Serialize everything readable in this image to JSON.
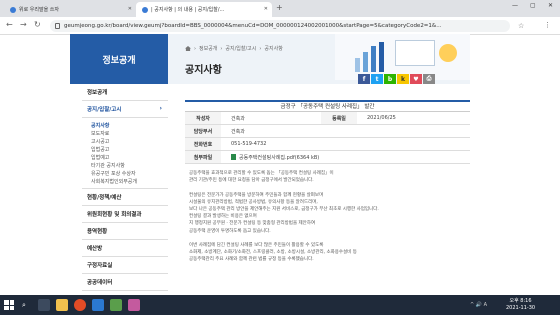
{
  "browser": {
    "tab1_title": "위로 우리말을 쓰자",
    "tab2_title": "| 공지사항 | 의 내용 | 공지/입찰/...",
    "url": "geumjeong.go.kr/board/view.geumj?boardId=BBS_0000004&menuCd=DOM_000000124002001000&startPage=5&categoryCode2=1&..."
  },
  "sidebar": {
    "header": "정보공개",
    "items": [
      {
        "label": "정보공개"
      },
      {
        "label": "공지/입찰/고시"
      },
      {
        "label": "현황/정책/예산"
      },
      {
        "label": "위원회현황 및 회의결과"
      },
      {
        "label": "용역현황"
      },
      {
        "label": "예산방"
      },
      {
        "label": "구정자료실"
      },
      {
        "label": "공공데이터"
      }
    ],
    "subitems": [
      "공지사항",
      "보도자료",
      "고시공고",
      "입법공고",
      "입법예고",
      "타기관 공지사항",
      "유공구민 포상 수상자",
      "사회복지법인외부공개"
    ]
  },
  "breadcrumb": [
    "정보공개",
    "공지/입찰/고시",
    "공지사항"
  ],
  "page_title": "공지사항",
  "share": [
    "f",
    "t",
    "b",
    "k",
    "♥",
    "⎙"
  ],
  "post": {
    "title": "금정구 「공동주택 컨설팅 사례집」 발간",
    "author_label": "작성자",
    "author": "건축과",
    "date_label": "등록일",
    "date": "2021/06/25",
    "dept_label": "담당부서",
    "dept": "건축과",
    "phone_label": "전화번호",
    "phone": "051-519-4732",
    "attach_label": "첨부파일",
    "attach": "공동주택컨설팅사례집.pdf(6364 kB)",
    "body": [
      "공동주택을 효과적으로 관리할 수 있도록 돕는 「공동주택 컨설팅 사례집」이",
      "관리 기관/주민 등에 대한 요청을 담아 금정구에서 발간되었습니다.",
      "",
      "컨설팅은 전문가가 공동주택을 방문하여 주민들과 함께 현황을 살펴보며",
      "시설물의 유지관리방법, 적법한 공사방법, 유의사항 등을 알려드리며,",
      "보다 나은 공동주택 관리 방안을 제안해주는 지원 서비스로, 금정구가 부산 최초로 시행한 사업입니다.",
      "컨설팅 결과 발생하는 비용은 없으며",
      "지 행정지원 공무원 · 전문가 컨설팅 등 맞춤형 관리방법을 제안하여",
      "공동주택 운영이 투명하도록 돕고 있습니다.",
      "",
      "이번 사례집에 담긴 컨설팅 사례를 보다 많은 주민들이 활용할 수 있도록",
      "소화제, 소방계단, 소화기/소화전, 스프링클러, 소방, 소방시설, 소방관리, 소화용수설비 등",
      "공동주택관리 주요 사례와 함께 관련 법률 규정 등을 수록했습니다."
    ]
  },
  "taskbar": {
    "time": "오후 8:16",
    "date": "2021-11-30",
    "tray": "^ 🔊 A"
  },
  "colors": {
    "brand": "#245ca6",
    "taskbar": "#1f2a3a"
  }
}
